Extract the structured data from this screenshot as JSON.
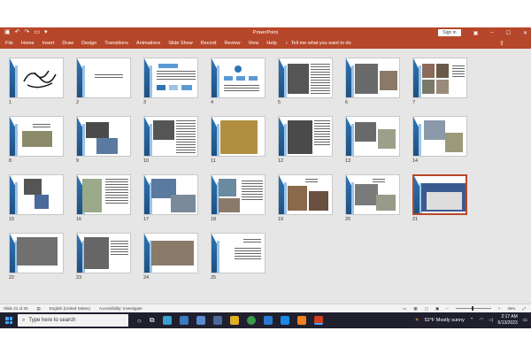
{
  "window": {
    "title": "PowerPoint",
    "sign_in": "Sign in",
    "qat_icons": [
      "save-icon",
      "undo-icon",
      "redo-icon",
      "present-icon",
      "customize-icon"
    ]
  },
  "ribbon": {
    "tabs": [
      "File",
      "Home",
      "Insert",
      "Draw",
      "Design",
      "Transitions",
      "Animations",
      "Slide Show",
      "Record",
      "Review",
      "View",
      "Help"
    ],
    "tell_me": "Tell me what you want to do"
  },
  "slides": [
    "1",
    "2",
    "3",
    "4",
    "5",
    "6",
    "7",
    "8",
    "9",
    "10",
    "11",
    "12",
    "13",
    "14",
    "15",
    "16",
    "17",
    "18",
    "19",
    "20",
    "21",
    "22",
    "23",
    "24",
    "25"
  ],
  "status": {
    "slide_count": "Slide 21 of 25",
    "language": "English (United States)",
    "accessibility": "Accessibility: Investigate",
    "zoom": "46%"
  },
  "taskbar": {
    "search_placeholder": "Type here to search",
    "weather": "52°F  Mostly sunny",
    "time": "2:17 AM",
    "date": "6/13/2023"
  }
}
